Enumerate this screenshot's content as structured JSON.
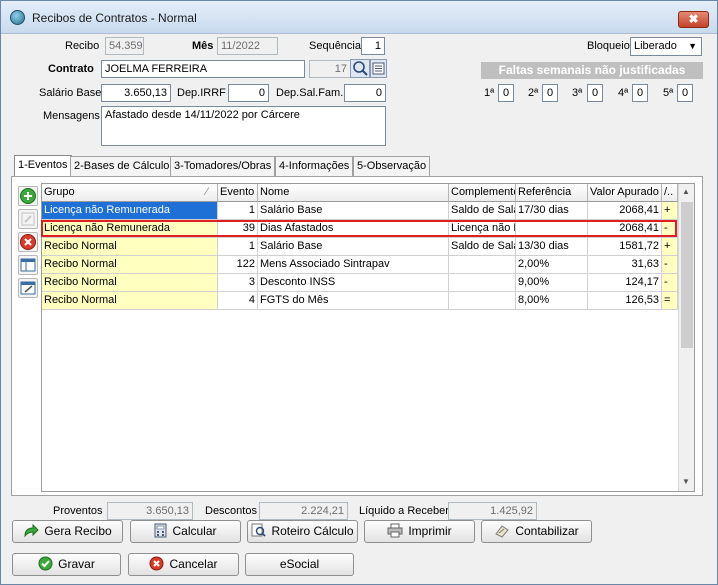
{
  "window": {
    "title": "Recibos de Contratos - Normal",
    "close_label": "✖"
  },
  "header": {
    "recibo_label": "Recibo",
    "recibo_value": "54.359",
    "mes_label": "Mês",
    "mes_value": "11/2022",
    "sequencia_label": "Sequência",
    "sequencia_value": "1",
    "bloqueio_label": "Bloqueio",
    "bloqueio_value": "Liberado",
    "contrato_label": "Contrato",
    "contrato_value": "JOELMA FERREIRA",
    "contrato_code": "17",
    "faltas_label": "Faltas semanais não justificadas",
    "salario_label": "Salário Base",
    "salario_value": "3.650,13",
    "irrf_label": "Dep.IRRF",
    "irrf_value": "0",
    "salfam_label": "Dep.Sal.Fam.",
    "salfam_value": "0",
    "mensagens_label": "Mensagens",
    "mensagens_value": "Afastado desde 14/11/2022 por Cárcere",
    "faltas": [
      {
        "label": "1ª",
        "value": "0"
      },
      {
        "label": "2ª",
        "value": "0"
      },
      {
        "label": "3ª",
        "value": "0"
      },
      {
        "label": "4ª",
        "value": "0"
      },
      {
        "label": "5ª",
        "value": "0"
      }
    ]
  },
  "tabs": [
    "1-Eventos",
    "2-Bases de Cálculo",
    "3-Tomadores/Obras",
    "4-Informações",
    "5-Observação"
  ],
  "grid": {
    "columns": [
      "Grupo",
      "Evento",
      "Nome",
      "Complemento",
      "Referência",
      "Valor Apurado",
      "/.."
    ],
    "rows": [
      [
        "Licença não Remunerada",
        "1",
        "Salário Base",
        "Saldo de Salário",
        "17/30 dias",
        "2068,41",
        "+"
      ],
      [
        "Licença não Remunerada",
        "39",
        "Dias Afastados",
        "Licença não Remunerada",
        "",
        "2068,41",
        "-"
      ],
      [
        "Recibo Normal",
        "1",
        "Salário Base",
        "Saldo de Salário",
        "13/30 dias",
        "1581,72",
        "+"
      ],
      [
        "Recibo Normal",
        "122",
        "Mens Associado Sintrapav",
        "",
        "2,00%",
        "31,63",
        "-"
      ],
      [
        "Recibo Normal",
        "3",
        "Desconto INSS",
        "",
        "9,00%",
        "124,17",
        "-"
      ],
      [
        "Recibo Normal",
        "4",
        "FGTS do Mês",
        "",
        "8,00%",
        "126,53",
        "="
      ]
    ]
  },
  "totals": {
    "proventos_label": "Proventos",
    "proventos_value": "3.650,13",
    "descontos_label": "Descontos",
    "descontos_value": "2.224,21",
    "liquido_label": "Líquido a Receber",
    "liquido_value": "1.425,92"
  },
  "buttons": {
    "gera_recibo": "Gera Recibo",
    "calcular": "Calcular",
    "roteiro": "Roteiro Cálculo",
    "imprimir": "Imprimir",
    "contabilizar": "Contabilizar",
    "gravar": "Gravar",
    "cancelar": "Cancelar",
    "esocial": "eSocial"
  }
}
